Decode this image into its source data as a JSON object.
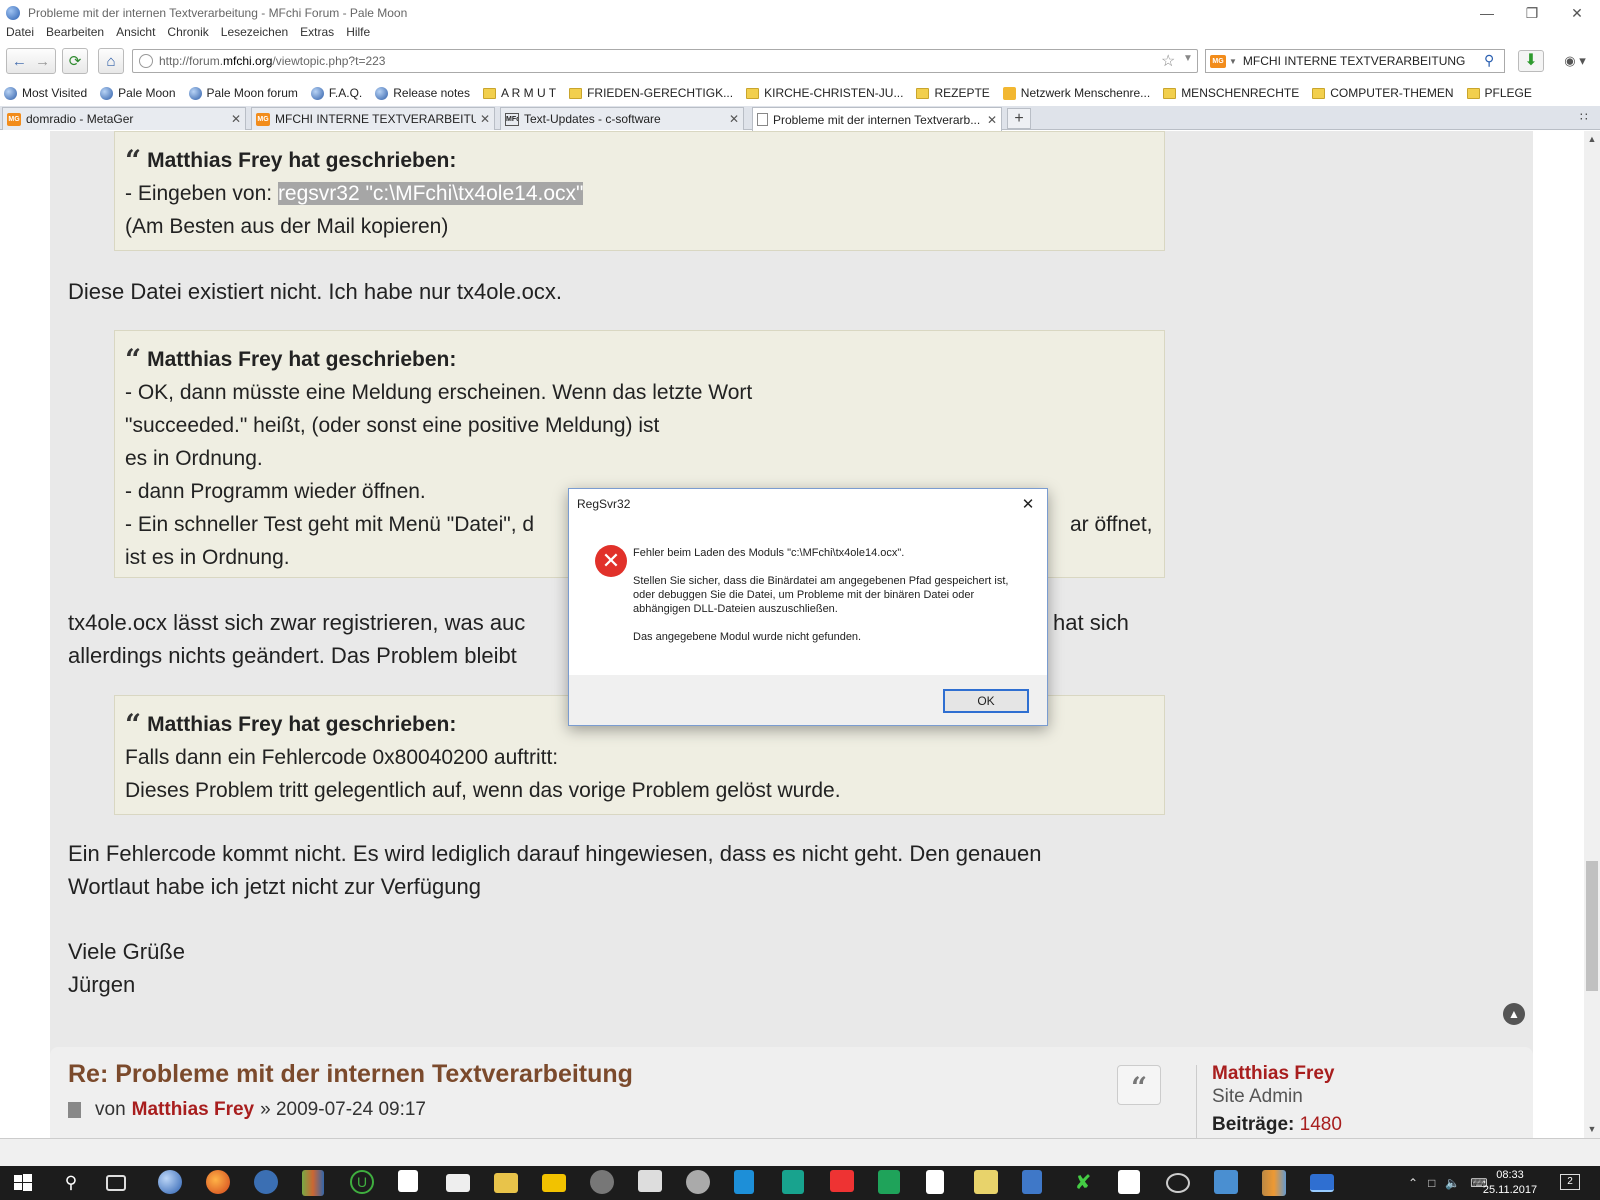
{
  "window": {
    "title": "Probleme mit der internen Textverarbeitung - MFchi Forum - Pale Moon"
  },
  "menu": [
    "Datei",
    "Bearbeiten",
    "Ansicht",
    "Chronik",
    "Lesezeichen",
    "Extras",
    "Hilfe"
  ],
  "nav": {
    "url_prefix": "http://forum.",
    "url_domain": "mfchi.org",
    "url_suffix": "/viewtopic.php?t=223",
    "search_value": "MFCHI INTERNE TEXTVERARBEITUNG",
    "search_engine_badge": "MG"
  },
  "bookmarks": [
    {
      "label": "Most Visited",
      "icon": "globe-icon"
    },
    {
      "label": "Pale Moon",
      "icon": "globe-icon"
    },
    {
      "label": "Pale Moon forum",
      "icon": "globe-icon"
    },
    {
      "label": "F.A.Q.",
      "icon": "globe-icon"
    },
    {
      "label": "Release notes",
      "icon": "globe-icon"
    },
    {
      "label": "A R M U T",
      "icon": "folder-icon"
    },
    {
      "label": "FRIEDEN-GERECHTIGK...",
      "icon": "folder-icon"
    },
    {
      "label": "KIRCHE-CHRISTEN-JU...",
      "icon": "folder-icon"
    },
    {
      "label": "REZEPTE",
      "icon": "folder-icon"
    },
    {
      "label": "Netzwerk Menschenre...",
      "icon": "rss-icon"
    },
    {
      "label": "MENSCHENRECHTE",
      "icon": "folder-icon"
    },
    {
      "label": "COMPUTER-THEMEN",
      "icon": "folder-icon"
    },
    {
      "label": "PFLEGE",
      "icon": "folder-icon"
    }
  ],
  "tabs": [
    {
      "label": "domradio - MetaGer",
      "badge": "MG"
    },
    {
      "label": "MFCHI INTERNE TEXTVERARBEITUN...",
      "badge": "MG"
    },
    {
      "label": "Text-Updates - c-software",
      "badge": "MFchi"
    },
    {
      "label": "Probleme mit der internen Textverarb...",
      "badge": ""
    }
  ],
  "post": {
    "quote1": {
      "head": "Matthias Frey hat geschrieben:",
      "line1_prefix": "- Eingeben von: ",
      "line1_highlight": "regsvr32 \"c:\\MFchi\\tx4ole14.ocx\"",
      "line2": "(Am Besten aus der Mail kopieren)"
    },
    "reply1": "Diese Datei existiert nicht. Ich habe nur tx4ole.ocx.",
    "quote2": {
      "head": "Matthias Frey hat geschrieben:",
      "line1": "- OK, dann müsste eine Meldung erscheinen. Wenn das letzte Wort",
      "line2": "\"succeeded.\" heißt, (oder sonst eine positive Meldung) ist",
      "line3": "es in Ordnung.",
      "line4": "- dann Programm wieder öffnen.",
      "line5a": "- Ein schneller Test geht mit Menü \"Datei\", d",
      "line5b": "ar öffnet,",
      "line6": "ist es in Ordnung."
    },
    "reply2a": "tx4ole.ocx lässt sich zwar registrieren, was auc",
    "reply2b": "hat sich",
    "reply2c": "allerdings nichts geändert. Das Problem bleibt",
    "quote3": {
      "head": "Matthias Frey hat geschrieben:",
      "line1": "Falls dann ein Fehlercode 0x80040200 auftritt:",
      "line2": "Dieses Problem tritt gelegentlich auf, wenn das vorige Problem gelöst wurde."
    },
    "reply3a": "Ein Fehlercode kommt nicht. Es wird lediglich darauf hingewiesen, dass es nicht geht. Den genauen",
    "reply3b": "Wortlaut habe ich jetzt nicht zur Verfügung",
    "greeting": "Viele Grüße",
    "signature": "Jürgen"
  },
  "next_post": {
    "title": "Re: Probleme mit der internen Textverarbeitung",
    "by": "von",
    "author": "Matthias Frey",
    "sep": "»",
    "datetime": "2009-07-24 09:17",
    "profile_name": "Matthias Frey",
    "profile_rank": "Site Admin",
    "posts_label": "Beiträge:",
    "posts_value": "1480"
  },
  "dialog": {
    "title": "RegSvr32",
    "msg1": "Fehler beim Laden des Moduls \"c:\\MFchi\\tx4ole14.ocx\".",
    "msg2": "Stellen Sie sicher, dass die Binärdatei am angegebenen Pfad gespeichert ist, oder debuggen Sie die Datei, um Probleme mit der binären Datei oder abhängigen DLL-Dateien auszuschließen.",
    "msg3": "Das angegebene Modul wurde nicht gefunden.",
    "ok": "OK"
  },
  "taskbar": {
    "time": "08:33",
    "date": "25.11.2017",
    "notif_count": "2"
  }
}
